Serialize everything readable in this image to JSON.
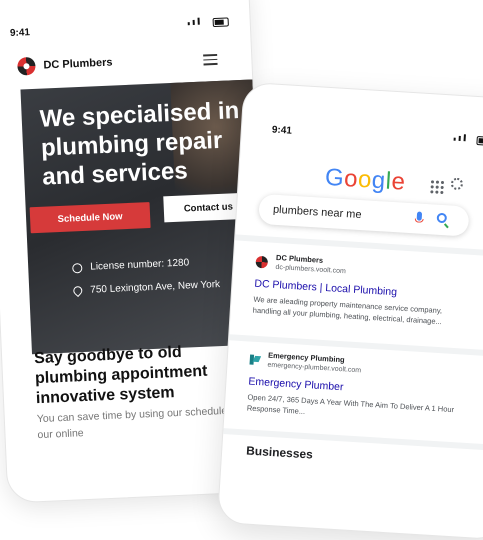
{
  "back_phone": {
    "time": "9:41",
    "brand": "DC Plumbers",
    "hero_title": "We specialised in plumbing repair and services",
    "primary_button": "Schedule Now",
    "secondary_button": "Contact us",
    "license": "License number: 1280",
    "address": "750 Lexington Ave, New York",
    "section_title": "Say goodbye to old plumbing appointment innovative system",
    "section_body": "You can save time by using our schedule with our online"
  },
  "front_phone": {
    "time": "9:41",
    "search_query": "plumbers near me",
    "results": [
      {
        "site": "DC Plumbers",
        "url": "dc-plumbers.voolt.com",
        "title": "DC Plumbers | Local Plumbing",
        "description": "We are aleading property maintenance service company, handling all your plumbing, heating, electrical, drainage..."
      },
      {
        "site": "Emergency Plumbing",
        "url": "emergency-plumber.voolt.com",
        "title": "Emergency Plumber",
        "description": "Open 24/7, 365 Days A Year With The Aim To Deliver A 1 Hour Response Time..."
      }
    ],
    "businesses_heading": "Businesses"
  }
}
